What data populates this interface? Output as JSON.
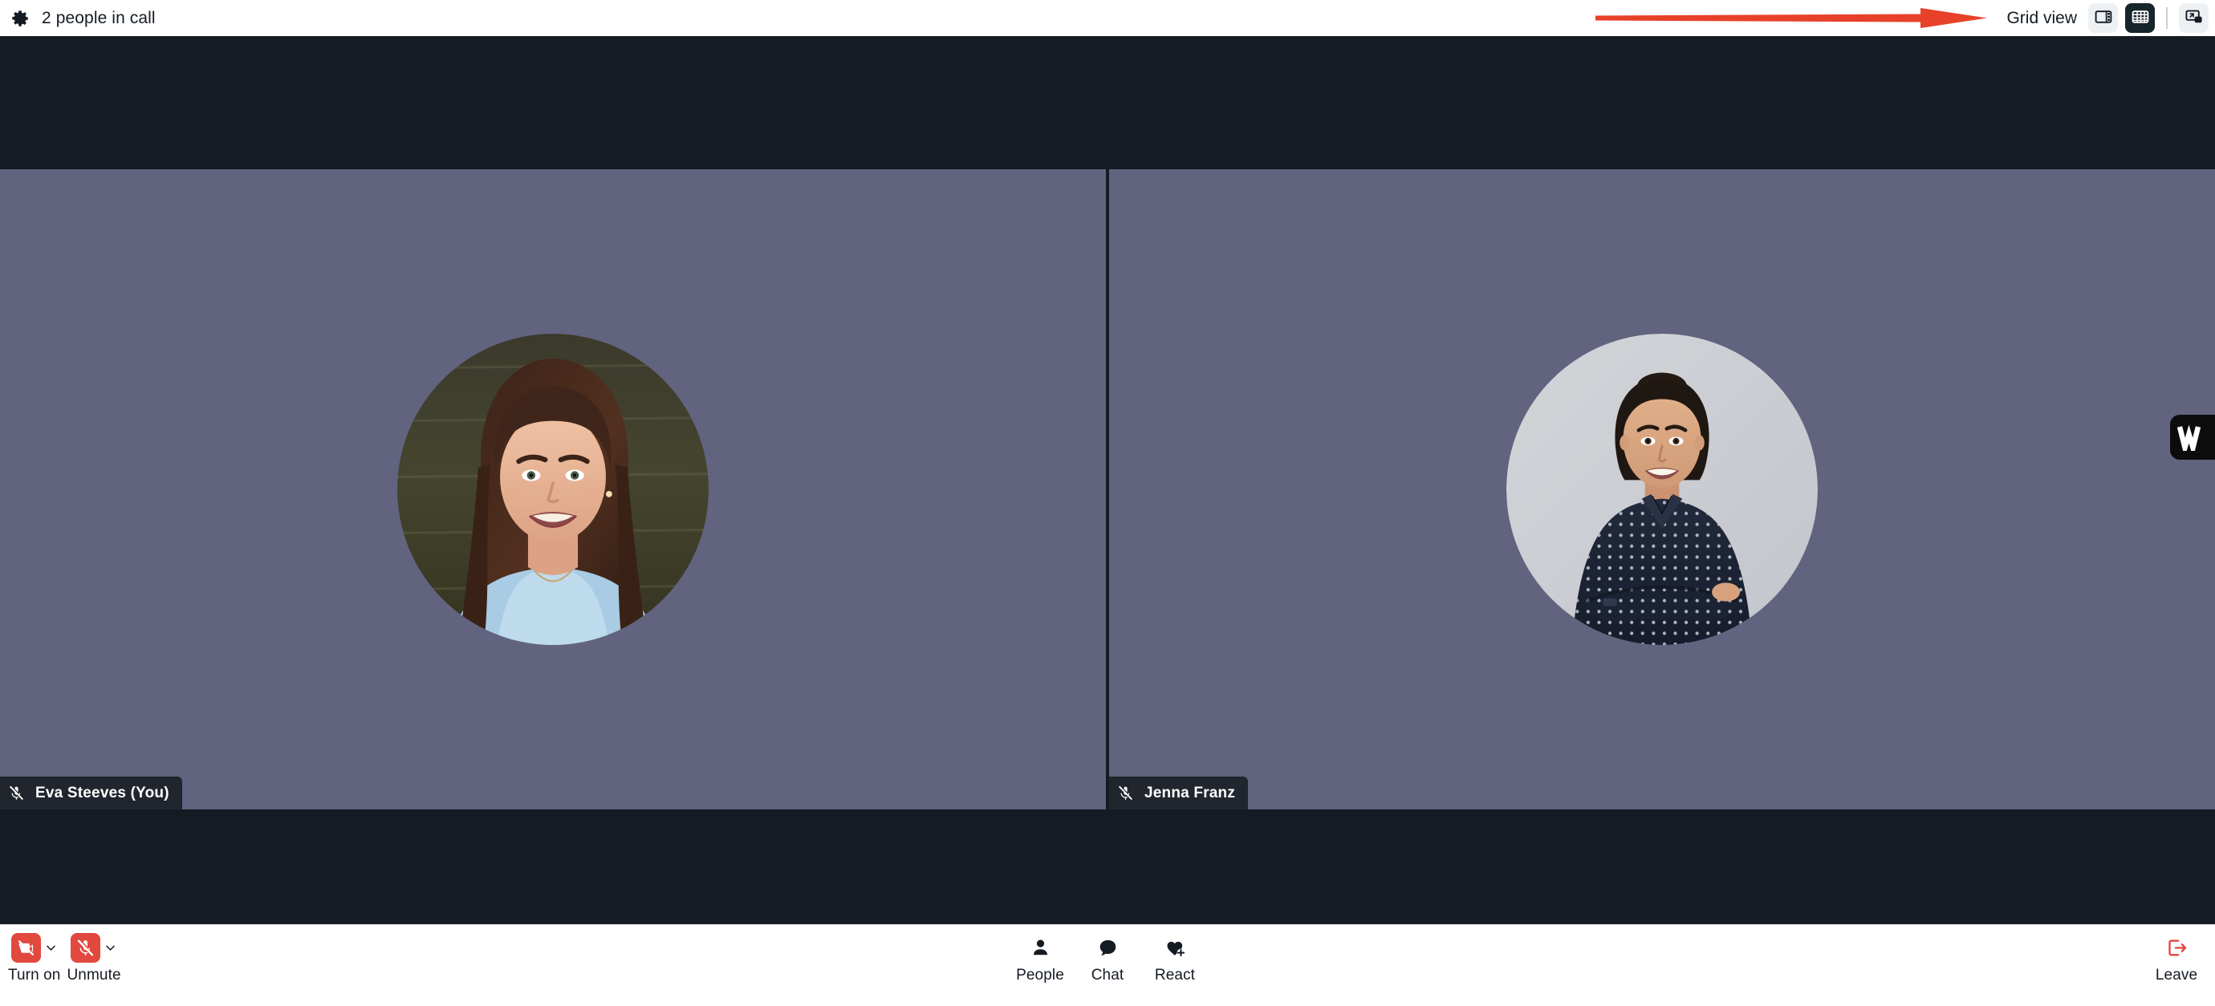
{
  "topbar": {
    "gear_icon": "gear-icon",
    "call_status": "2 people in call",
    "view_mode_label": "Grid view",
    "buttons": [
      {
        "name": "sidebar-view-button",
        "icon": "sidebar-view-icon",
        "active": false
      },
      {
        "name": "grid-view-button",
        "icon": "grid-view-icon",
        "active": true
      },
      {
        "name": "picture-in-picture-button",
        "icon": "picture-in-picture-icon",
        "active": false
      }
    ]
  },
  "annotation": {
    "type": "arrow",
    "direction": "right",
    "color": "#e8412a",
    "points_to": "Grid view"
  },
  "stage": {
    "background_color": "#141b23",
    "tile_background_color": "#62637f",
    "participants": [
      {
        "name": "Eva Steeves (You)",
        "muted": true,
        "mic_icon": "mic-off-icon",
        "avatar": "avatar-eva",
        "avatar_description": "Smiling woman with long dark brown hair in a light blue top against a dark olive wall"
      },
      {
        "name": "Jenna Franz",
        "muted": true,
        "mic_icon": "mic-off-icon",
        "avatar": "avatar-jenna",
        "avatar_description": "Smiling woman with dark hair tied back, arms crossed, navy polka-dot shirt on a light gray background"
      }
    ],
    "brand_badge": {
      "name": "brand-badge",
      "letter": "W",
      "color": "#0c0c0c"
    }
  },
  "controls": {
    "left": [
      {
        "name": "camera-toggle-button",
        "icon": "camera-off-icon",
        "label": "Turn on",
        "state": "off",
        "color": "#e1483e",
        "has_menu": true
      },
      {
        "name": "mic-toggle-button",
        "icon": "mic-off-icon",
        "label": "Unmute",
        "state": "muted",
        "color": "#e1483e",
        "has_menu": true
      }
    ],
    "center": [
      {
        "name": "people-button",
        "icon": "people-icon",
        "label": "People"
      },
      {
        "name": "chat-button",
        "icon": "chat-bubble-icon",
        "label": "Chat"
      },
      {
        "name": "react-button",
        "icon": "react-heart-plus-icon",
        "label": "React"
      }
    ],
    "right": [
      {
        "name": "leave-call-button",
        "icon": "leave-icon",
        "label": "Leave",
        "color": "#e1483e"
      }
    ]
  },
  "colors": {
    "accent_danger": "#e1483e",
    "annotation": "#e8412a",
    "dark_chrome": "#141b23",
    "tile_bg": "#62637f",
    "nameplate_bg": "#21262e",
    "button_idle_bg": "#eef1f4"
  }
}
